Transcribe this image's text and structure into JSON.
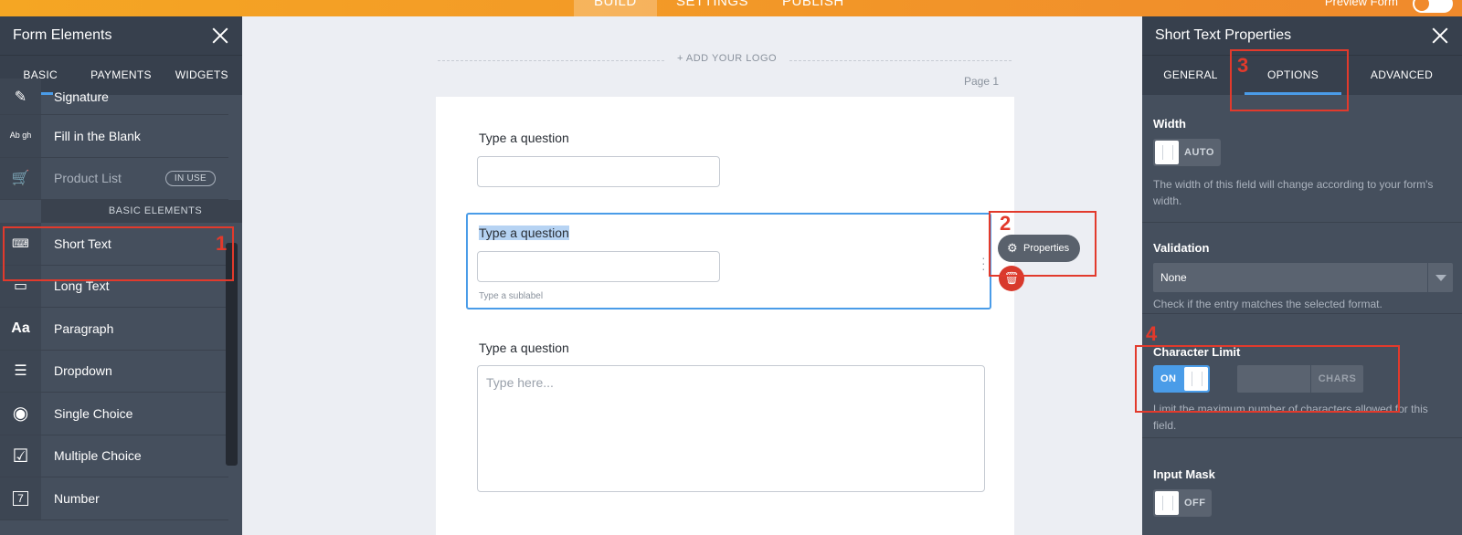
{
  "topbar": {
    "tabs": [
      "BUILD",
      "SETTINGS",
      "PUBLISH"
    ],
    "preview_label": "Preview Form"
  },
  "left_panel": {
    "title": "Form Elements",
    "tabs": [
      "BASIC",
      "PAYMENTS",
      "WIDGETS"
    ],
    "items_top": [
      {
        "label": "Signature",
        "icon": "signature-icon"
      },
      {
        "label": "Fill in the Blank",
        "icon": "fill-blank-icon",
        "icon_text": "Ab gh"
      },
      {
        "label": "Product List",
        "icon": "cart-icon",
        "badge": "IN USE"
      }
    ],
    "section_label": "BASIC ELEMENTS",
    "items": [
      {
        "label": "Short Text",
        "icon": "short-text-icon"
      },
      {
        "label": "Long Text",
        "icon": "long-text-icon"
      },
      {
        "label": "Paragraph",
        "icon": "paragraph-icon",
        "icon_text": "Aa"
      },
      {
        "label": "Dropdown",
        "icon": "dropdown-icon"
      },
      {
        "label": "Single Choice",
        "icon": "radio-icon"
      },
      {
        "label": "Multiple Choice",
        "icon": "checkbox-icon"
      },
      {
        "label": "Number",
        "icon": "number-icon",
        "icon_text": "7"
      }
    ]
  },
  "canvas": {
    "add_logo": "+ ADD YOUR LOGO",
    "page_label": "Page 1",
    "questions": [
      {
        "label": "Type a question"
      },
      {
        "label": "Type a question",
        "sublabel": "Type a sublabel"
      },
      {
        "label": "Type a question",
        "placeholder": "Type here..."
      }
    ],
    "properties_button": "Properties"
  },
  "right_panel": {
    "title": "Short Text Properties",
    "tabs": [
      "GENERAL",
      "OPTIONS",
      "ADVANCED"
    ],
    "width": {
      "label": "Width",
      "toggle": "AUTO",
      "help": "The width of this field will change according to your form's width."
    },
    "validation": {
      "label": "Validation",
      "value": "None",
      "help": "Check if the entry matches the selected format."
    },
    "char_limit": {
      "label": "Character Limit",
      "toggle": "ON",
      "unit": "CHARS",
      "help": "Limit the maximum number of characters allowed for this field."
    },
    "input_mask": {
      "label": "Input Mask",
      "toggle": "OFF"
    }
  },
  "annotations": [
    "1",
    "2",
    "3",
    "4"
  ],
  "colors": {
    "accent": "#4a9ce8",
    "annotation": "#e23a2c",
    "panel": "#454f5d",
    "topbar": "#f08a2c"
  }
}
